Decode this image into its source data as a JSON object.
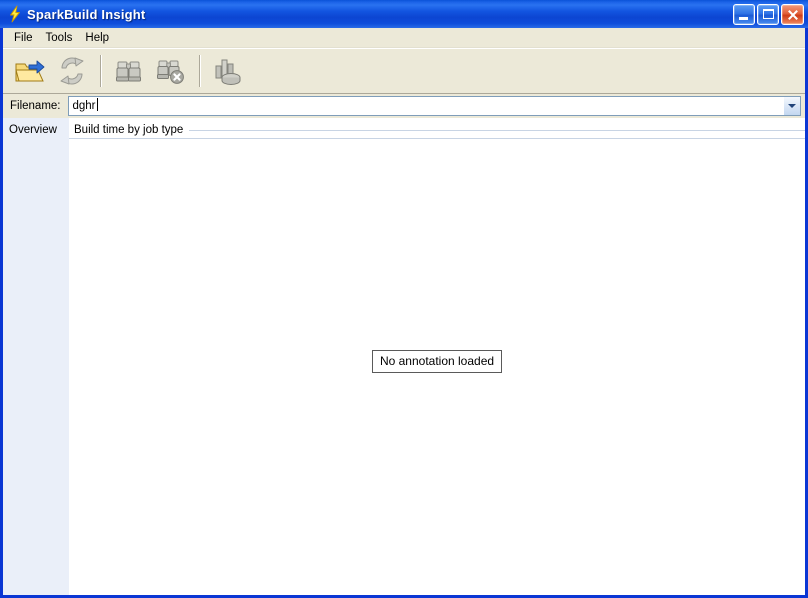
{
  "window": {
    "title": "SparkBuild Insight",
    "app_icon": "lightning-bolt-icon",
    "caption_buttons": [
      {
        "name": "minimize",
        "label": "_"
      },
      {
        "name": "maximize",
        "label": "□"
      },
      {
        "name": "close",
        "label": "✕"
      }
    ]
  },
  "menubar": {
    "items": [
      {
        "label": "File"
      },
      {
        "label": "Tools"
      },
      {
        "label": "Help"
      }
    ]
  },
  "toolbar": {
    "buttons": [
      {
        "name": "open-file",
        "icon": "open-folder-icon",
        "label": "Open",
        "enabled": true
      },
      {
        "name": "refresh",
        "icon": "refresh-icon",
        "label": "Refresh",
        "enabled": false
      },
      {
        "name": "find",
        "icon": "binoculars-icon",
        "label": "Find",
        "enabled": false
      },
      {
        "name": "clear-find",
        "icon": "binoculars-cancel-icon",
        "label": "Clear Find",
        "enabled": false
      },
      {
        "name": "statistics",
        "icon": "chart-database-icon",
        "label": "Statistics",
        "enabled": false
      }
    ]
  },
  "filename_row": {
    "label": "Filename:",
    "value": "dghr",
    "placeholder": ""
  },
  "sidebar": {
    "label": "Overview"
  },
  "content": {
    "group_title": "Build time by job type",
    "empty_message": "No annotation loaded"
  },
  "colors": {
    "titlebar_blue": "#0b53d8",
    "frame_blue": "#0a36d4",
    "chrome_beige": "#ece9d8",
    "sidebar_blue": "#eaeff9",
    "rule_blue": "#c8d4e4",
    "close_red": "#cf3c17"
  }
}
